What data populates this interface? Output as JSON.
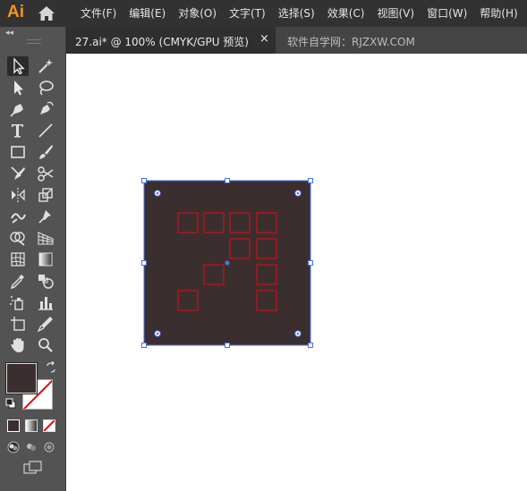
{
  "app": {
    "logo_text": "Ai"
  },
  "menubar": {
    "items": [
      {
        "id": "file",
        "label": "文件(F)"
      },
      {
        "id": "edit",
        "label": "编辑(E)"
      },
      {
        "id": "object",
        "label": "对象(O)"
      },
      {
        "id": "type",
        "label": "文字(T)"
      },
      {
        "id": "select",
        "label": "选择(S)"
      },
      {
        "id": "effect",
        "label": "效果(C)"
      },
      {
        "id": "view",
        "label": "视图(V)"
      },
      {
        "id": "window",
        "label": "窗口(W)"
      },
      {
        "id": "help",
        "label": "帮助(H)"
      }
    ]
  },
  "toolbar": {
    "collapse_label": "◂◂",
    "tools": [
      {
        "name": "selection-tool",
        "icon": "arrow-outline",
        "active": true
      },
      {
        "name": "magic-wand-tool",
        "icon": "magic-wand"
      },
      {
        "name": "direct-selection-tool",
        "icon": "arrow-solid"
      },
      {
        "name": "lasso-tool",
        "icon": "lasso"
      },
      {
        "name": "pen-tool",
        "icon": "pen"
      },
      {
        "name": "curvature-tool",
        "icon": "curvature-pen"
      },
      {
        "name": "type-tool",
        "icon": "type"
      },
      {
        "name": "line-segment-tool",
        "icon": "line"
      },
      {
        "name": "rectangle-tool",
        "icon": "rectangle"
      },
      {
        "name": "paintbrush-tool",
        "icon": "brush"
      },
      {
        "name": "shaper-tool",
        "icon": "shaper"
      },
      {
        "name": "scissors-tool",
        "icon": "scissors"
      },
      {
        "name": "reflect-tool",
        "icon": "reflect"
      },
      {
        "name": "scale-tool",
        "icon": "scale"
      },
      {
        "name": "warp-tool",
        "icon": "warp"
      },
      {
        "name": "puppet-warp-tool",
        "icon": "pin"
      },
      {
        "name": "shape-builder-tool",
        "icon": "shape-builder"
      },
      {
        "name": "perspective-grid-tool",
        "icon": "perspective-grid"
      },
      {
        "name": "mesh-tool",
        "icon": "mesh"
      },
      {
        "name": "gradient-tool",
        "icon": "gradient"
      },
      {
        "name": "eyedropper-tool",
        "icon": "eyedropper"
      },
      {
        "name": "blend-tool",
        "icon": "blend"
      },
      {
        "name": "symbol-sprayer-tool",
        "icon": "symbol-sprayer"
      },
      {
        "name": "column-graph-tool",
        "icon": "column-graph"
      },
      {
        "name": "artboard-tool",
        "icon": "artboard"
      },
      {
        "name": "slice-tool",
        "icon": "slice"
      },
      {
        "name": "hand-tool",
        "icon": "hand"
      },
      {
        "name": "zoom-tool",
        "icon": "zoom"
      }
    ],
    "fill_color": "#3a2f2e",
    "stroke_color": "none"
  },
  "document_tab": {
    "title": "27.ai* @ 100% (CMYK/GPU 预览)",
    "close_label": "×"
  },
  "tab_watermark": "软件自学网：RJZXW.COM",
  "artwork": {
    "background_color": "#3a2f2e",
    "square_stroke_color": "#c0111b",
    "selection_color": "#4a6fe8"
  }
}
